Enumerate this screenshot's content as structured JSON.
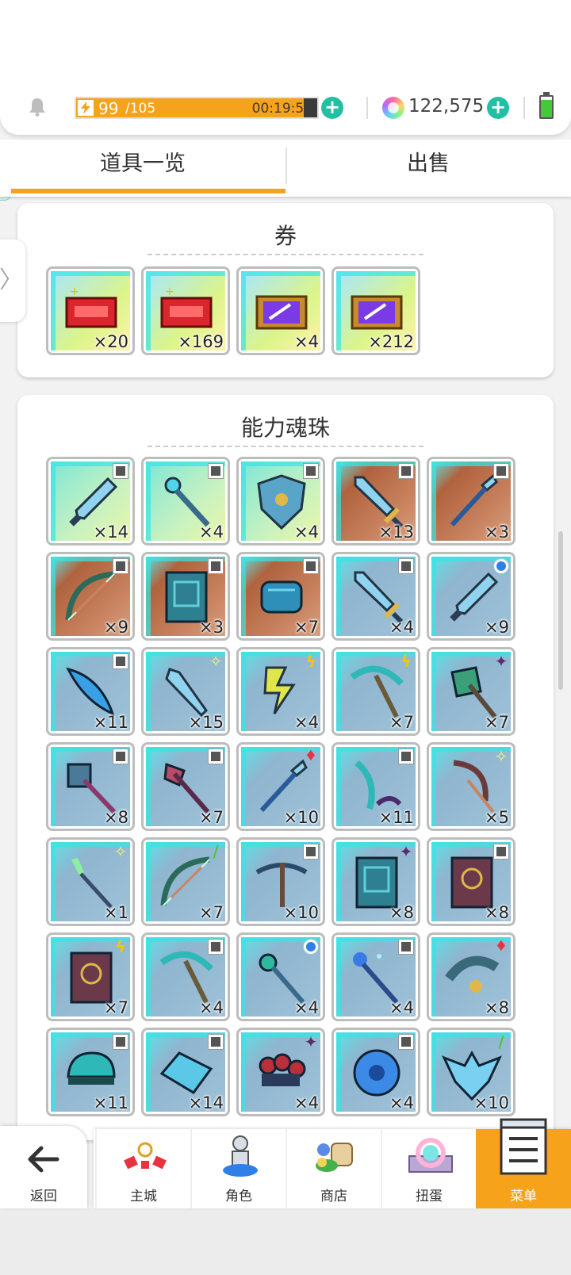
{
  "status": {
    "stamina_current": "99",
    "stamina_max": "/105",
    "stamina_fill_fraction": 0.943,
    "timer": "00:19:52",
    "gems": "122,575"
  },
  "tabs": [
    {
      "label": "道具一览",
      "active": true
    },
    {
      "label": "出售",
      "active": false
    }
  ],
  "side_tab": {
    "glyph": "〉"
  },
  "sections": {
    "coupons": {
      "title": "券",
      "items": [
        {
          "name": "red-ticket-plus",
          "count": "×20"
        },
        {
          "name": "red-ticket-plus-alt",
          "count": "×169"
        },
        {
          "name": "purple-ticket-stack",
          "count": "×4"
        },
        {
          "name": "purple-ticket",
          "count": "×212"
        }
      ]
    },
    "orbs": {
      "title": "能力魂珠",
      "items": [
        {
          "icon": "dagger-icon",
          "bg": "green",
          "attr": "grey",
          "count": "×14"
        },
        {
          "icon": "staff-icon",
          "bg": "green",
          "attr": "grey",
          "count": "×4"
        },
        {
          "icon": "shield-icon",
          "bg": "green",
          "attr": "grey",
          "count": "×4"
        },
        {
          "icon": "sword-icon",
          "bg": "brown",
          "attr": "grey",
          "count": "×13"
        },
        {
          "icon": "spear-icon",
          "bg": "brown",
          "attr": "grey",
          "count": "×3"
        },
        {
          "icon": "bow-icon",
          "bg": "brown",
          "attr": "grey",
          "count": "×9"
        },
        {
          "icon": "book-icon",
          "bg": "brown",
          "attr": "grey",
          "count": "×3"
        },
        {
          "icon": "bracer-icon",
          "bg": "brown",
          "attr": "grey",
          "count": "×7"
        },
        {
          "icon": "sword-icon",
          "bg": "blue",
          "attr": "grey",
          "count": "×4"
        },
        {
          "icon": "dagger-icon",
          "bg": "blue",
          "attr": "blue",
          "count": "×9"
        },
        {
          "icon": "feather-blade-icon",
          "bg": "blue",
          "attr": "grey",
          "count": "×11"
        },
        {
          "icon": "kunai-icon",
          "bg": "blue",
          "attr": "light",
          "count": "×15"
        },
        {
          "icon": "lightning-spear-icon",
          "bg": "blue",
          "attr": "bolt",
          "count": "×4"
        },
        {
          "icon": "pickaxe-icon",
          "bg": "blue",
          "attr": "bolt",
          "count": "×7"
        },
        {
          "icon": "axe-icon",
          "bg": "blue",
          "attr": "dark",
          "count": "×7"
        },
        {
          "icon": "mace-icon",
          "bg": "blue",
          "attr": "grey",
          "count": "×8"
        },
        {
          "icon": "halberd-icon",
          "bg": "blue",
          "attr": "grey",
          "count": "×7"
        },
        {
          "icon": "spear-icon",
          "bg": "blue",
          "attr": "fire",
          "count": "×10"
        },
        {
          "icon": "scythe-icon",
          "bg": "blue",
          "attr": "grey",
          "count": "×11"
        },
        {
          "icon": "sickle-icon",
          "bg": "blue",
          "attr": "light",
          "count": "×5"
        },
        {
          "icon": "wand-icon",
          "bg": "blue",
          "attr": "light",
          "count": "×1"
        },
        {
          "icon": "bow-icon",
          "bg": "blue",
          "attr": "wind",
          "count": "×7"
        },
        {
          "icon": "crossbow-icon",
          "bg": "blue",
          "attr": "grey",
          "count": "×10"
        },
        {
          "icon": "book-icon",
          "bg": "blue",
          "attr": "dark",
          "count": "×8"
        },
        {
          "icon": "tome-icon",
          "bg": "blue",
          "attr": "grey",
          "count": "×8"
        },
        {
          "icon": "tome-icon",
          "bg": "blue",
          "attr": "bolt",
          "count": "×7"
        },
        {
          "icon": "pickaxe-icon",
          "bg": "blue",
          "attr": "grey",
          "count": "×4"
        },
        {
          "icon": "scepter-icon",
          "bg": "blue",
          "attr": "blue",
          "count": "×4"
        },
        {
          "icon": "magic-staff-icon",
          "bg": "blue",
          "attr": "grey",
          "count": "×4"
        },
        {
          "icon": "crescent-blade-icon",
          "bg": "blue",
          "attr": "fire",
          "count": "×8"
        },
        {
          "icon": "helmet-icon",
          "bg": "blue",
          "attr": "grey",
          "count": "×11"
        },
        {
          "icon": "gauntlet-icon",
          "bg": "blue",
          "attr": "grey",
          "count": "×14"
        },
        {
          "icon": "knuckle-icon",
          "bg": "blue",
          "attr": "dark",
          "count": "×4"
        },
        {
          "icon": "round-shield-icon",
          "bg": "blue",
          "attr": "grey",
          "count": "×4"
        },
        {
          "icon": "winged-shield-icon",
          "bg": "blue",
          "attr": "wind",
          "count": "×10"
        }
      ]
    }
  },
  "nav": {
    "back": "返回",
    "items": [
      {
        "label": "主城",
        "icon": "town-icon",
        "active": false
      },
      {
        "label": "角色",
        "icon": "character-icon",
        "active": false
      },
      {
        "label": "商店",
        "icon": "shop-icon",
        "active": false
      },
      {
        "label": "扭蛋",
        "icon": "gacha-icon",
        "active": false
      },
      {
        "label": "菜单",
        "icon": "menu-icon",
        "active": true
      }
    ]
  },
  "colors": {
    "accent_orange": "#f7a21b",
    "plus_teal": "#22c0a3",
    "frame_cyan": "#36e6e6"
  }
}
